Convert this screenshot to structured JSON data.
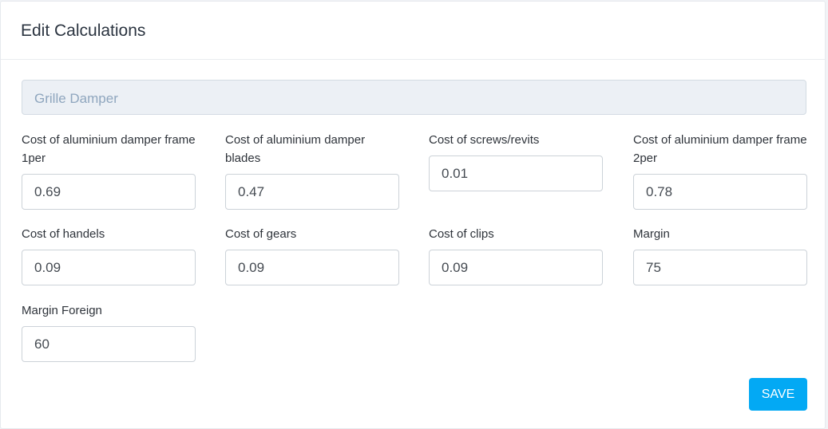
{
  "header": {
    "title": "Edit Calculations"
  },
  "product": {
    "name": "Grille Damper"
  },
  "fields": [
    {
      "label": "Cost of aluminium damper frame 1per",
      "value": "0.69"
    },
    {
      "label": "Cost of aluminium damper blades",
      "value": "0.47"
    },
    {
      "label": "Cost of screws/revits",
      "value": "0.01"
    },
    {
      "label": "Cost of aluminium damper frame 2per",
      "value": "0.78"
    },
    {
      "label": "Cost of handels",
      "value": "0.09"
    },
    {
      "label": "Cost of gears",
      "value": "0.09"
    },
    {
      "label": "Cost of clips",
      "value": "0.09"
    },
    {
      "label": "Margin",
      "value": "75"
    },
    {
      "label": "Margin Foreign",
      "value": "60"
    }
  ],
  "actions": {
    "save_label": "SAVE"
  },
  "colors": {
    "accent": "#03a9f4"
  }
}
